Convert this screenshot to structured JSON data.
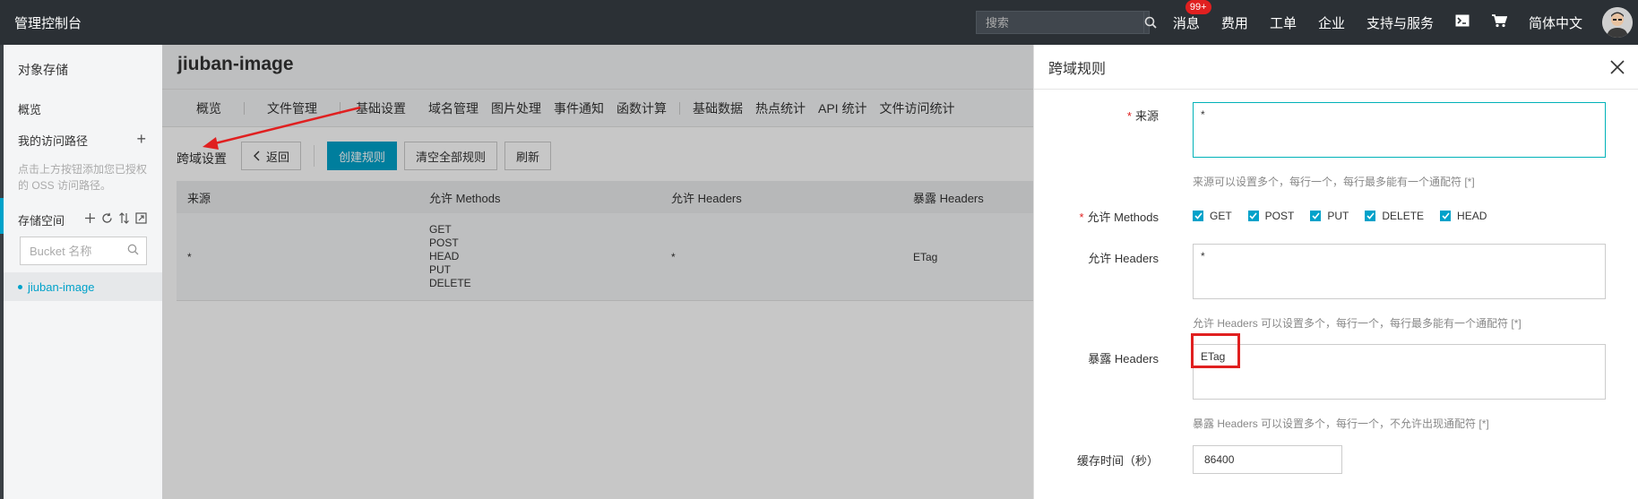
{
  "topbar": {
    "brand": "管理控制台",
    "search_placeholder": "搜索",
    "nav": [
      {
        "label": "消息",
        "badge": "99+"
      },
      {
        "label": "费用"
      },
      {
        "label": "工单"
      },
      {
        "label": "企业"
      },
      {
        "label": "支持与服务"
      }
    ],
    "language": "简体中文"
  },
  "sidebar": {
    "title": "对象存储",
    "overview": "概览",
    "my_paths": "我的访问路径",
    "paths_hint": "点击上方按钮添加您已授权的 OSS 访问路径。",
    "storage_space": "存储空间",
    "bucket_search_placeholder": "Bucket 名称",
    "buckets": [
      "jiuban-image"
    ]
  },
  "main": {
    "bucket_title": "jiuban-image",
    "tabs": [
      "概览",
      "文件管理",
      "基础设置",
      "域名管理",
      "图片处理",
      "事件通知",
      "函数计算",
      "基础数据",
      "热点统计",
      "API 统计",
      "文件访问统计"
    ],
    "active_tab": "基础设置",
    "section_label": "跨域设置",
    "back_button": "返回",
    "create_button": "创建规则",
    "clear_button": "清空全部规则",
    "refresh_button": "刷新",
    "table": {
      "headers": [
        "来源",
        "允许 Methods",
        "允许 Headers",
        "暴露 Headers"
      ],
      "rows": [
        {
          "origin": "*",
          "methods": [
            "GET",
            "POST",
            "HEAD",
            "PUT",
            "DELETE"
          ],
          "allow_headers": "*",
          "expose_headers": "ETag"
        }
      ]
    }
  },
  "panel": {
    "title": "跨域规则",
    "origin_label": "来源",
    "origin_value": "*",
    "origin_hint": "来源可以设置多个，每行一个，每行最多能有一个通配符 [*]",
    "methods_label": "允许 Methods",
    "methods": [
      "GET",
      "POST",
      "PUT",
      "DELETE",
      "HEAD"
    ],
    "allow_headers_label": "允许 Headers",
    "allow_headers_value": "*",
    "allow_headers_hint": "允许 Headers 可以设置多个，每行一个，每行最多能有一个通配符 [*]",
    "expose_headers_label": "暴露 Headers",
    "expose_headers_value": "ETag",
    "expose_headers_hint": "暴露 Headers 可以设置多个，每行一个，不允许出现通配符 [*]",
    "cache_label": "缓存时间（秒）",
    "cache_value": "86400"
  },
  "colors": {
    "topbar": "#2b3035",
    "accent": "#00a2ca",
    "annotation": "#e02020"
  }
}
